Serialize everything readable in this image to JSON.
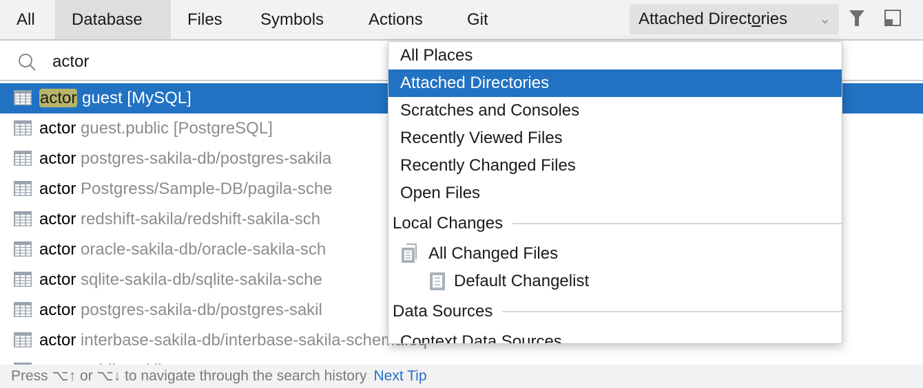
{
  "tabs": [
    {
      "label": "All"
    },
    {
      "label": "Database"
    },
    {
      "label": "Files"
    },
    {
      "label": "Symbols"
    },
    {
      "label": "Actions"
    },
    {
      "label": "Git"
    }
  ],
  "scope": {
    "pre": "Attached Direct",
    "mnemonic": "o",
    "post": "ries"
  },
  "search": {
    "value": "actor"
  },
  "results": [
    {
      "name": "actor",
      "location": "guest [MySQL]"
    },
    {
      "name": "actor",
      "location": "guest.public [PostgreSQL]"
    },
    {
      "name": "actor",
      "location": "postgres-sakila-db/postgres-sakila"
    },
    {
      "name": "actor",
      "location": "Postgress/Sample-DB/pagila-sche"
    },
    {
      "name": "actor",
      "location": "redshift-sakila/redshift-sakila-sch"
    },
    {
      "name": "actor",
      "location": "oracle-sakila-db/oracle-sakila-sch"
    },
    {
      "name": "actor",
      "location": "sqlite-sakila-db/sqlite-sakila-sche"
    },
    {
      "name": "actor",
      "location": "postgres-sakila-db/postgres-sakil"
    },
    {
      "name": "actor",
      "location": "interbase-sakila-db/interbase-sakila-schema.eq"
    },
    {
      "name": "actor",
      "location": "public.sakila"
    }
  ],
  "popup": {
    "items": [
      "All Places",
      "Attached Directories",
      "Scratches and Consoles",
      "Recently Viewed Files",
      "Recently Changed Files",
      "Open Files"
    ],
    "local_changes": "Local Changes",
    "all_changed": "All Changed Files",
    "default_changelist": "Default Changelist",
    "data_sources": "Data Sources",
    "context_data_sources": "Context Data Sources"
  },
  "footer": {
    "tip": "Press ⌥↑ or ⌥↓ to navigate through the search history",
    "next_tip": "Next Tip"
  },
  "colors": {
    "accent": "#2172c3",
    "highlight": "#b9b46a"
  }
}
